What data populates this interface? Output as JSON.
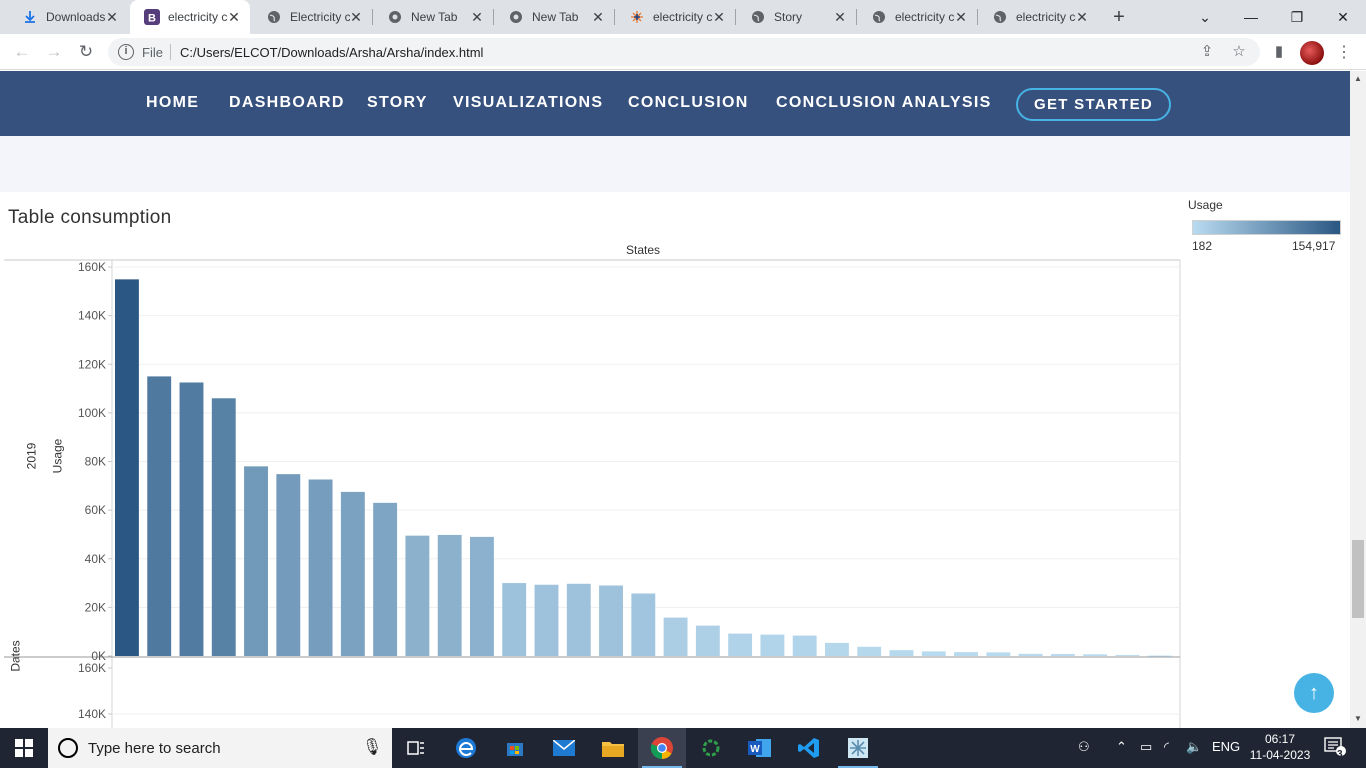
{
  "browser": {
    "tabs": [
      {
        "title": "Downloads",
        "icon": "download-icon",
        "active": false
      },
      {
        "title": "electricity consumption",
        "icon": "b-icon",
        "active": true
      },
      {
        "title": "Electricity consumption",
        "icon": "globe-icon",
        "active": false
      },
      {
        "title": "New Tab",
        "icon": "chrome-icon",
        "active": false
      },
      {
        "title": "New Tab",
        "icon": "chrome-icon",
        "active": false
      },
      {
        "title": "electricity consumption",
        "icon": "tableau-icon",
        "active": false
      },
      {
        "title": "Story",
        "icon": "globe-icon",
        "active": false
      },
      {
        "title": "electricity consumption",
        "icon": "globe-icon",
        "active": false
      },
      {
        "title": "electricity consumption",
        "icon": "globe-icon",
        "active": false
      }
    ],
    "scheme_label": "File",
    "url": "C:/Users/ELCOT/Downloads/Arsha/Arsha/index.html"
  },
  "site_nav": {
    "links": [
      "HOME",
      "DASHBOARD",
      "STORY",
      "VISUALIZATIONS",
      "CONCLUSION",
      "CONCLUSION ANALYSIS"
    ],
    "cta": "GET STARTED"
  },
  "viz": {
    "title": "Table consumption",
    "column_header": "States",
    "row_labels": {
      "year": "2019",
      "measure": "Usage",
      "dates": "Dates"
    },
    "legend": {
      "title": "Usage",
      "min": "182",
      "max": "154,917"
    }
  },
  "chart_data": {
    "type": "bar",
    "title": "Table consumption",
    "xlabel": "States",
    "ylabel": "Usage",
    "ylim": [
      0,
      160000
    ],
    "yticks": [
      "0K",
      "20K",
      "40K",
      "60K",
      "80K",
      "100K",
      "120K",
      "140K",
      "160K"
    ],
    "second_panel_yticks": [
      "160K",
      "140K"
    ],
    "color_scale": {
      "measure": "Usage",
      "min": 182,
      "max": 154917,
      "min_color": "#b9dbf0",
      "max_color": "#2a5783"
    },
    "values": [
      154917,
      115000,
      112500,
      106000,
      78000,
      74800,
      72600,
      67500,
      63000,
      49500,
      49800,
      49000,
      30000,
      29300,
      29700,
      29000,
      25700,
      15800,
      12500,
      9200,
      8800,
      8400,
      5400,
      3800,
      2400,
      1900,
      1600,
      1500,
      900,
      800,
      700,
      400,
      182
    ]
  },
  "taskbar": {
    "search_placeholder": "Type here to search",
    "apps": [
      "task-view-icon",
      "edge-icon",
      "store-icon",
      "mail-icon",
      "file-explorer-icon",
      "chrome-icon",
      "circle-app-icon",
      "word-icon",
      "vscode-icon",
      "snowflake-app-icon"
    ],
    "language": "ENG",
    "time": "06:17",
    "date": "11-04-2023",
    "notification_count": "3"
  },
  "colors": {
    "navbar": "#37517e",
    "accent": "#47b2e4",
    "band": "#f3f5fa"
  }
}
